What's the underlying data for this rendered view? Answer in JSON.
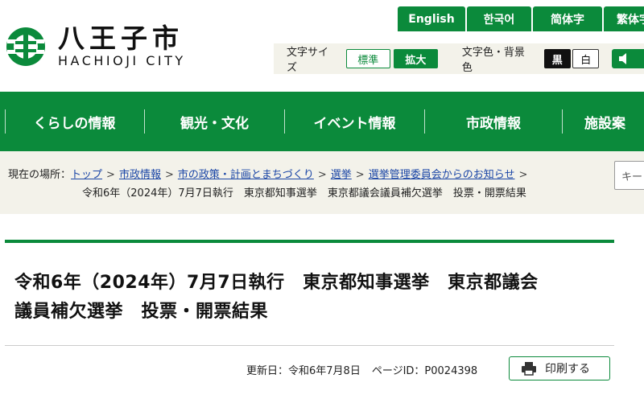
{
  "site": {
    "name_jp": "八王子市",
    "name_en": "HACHIOJI CITY",
    "logo_icon": "hachioji-emblem-icon",
    "brand_color": "#0b8a3b"
  },
  "languages": [
    "English",
    "한국어",
    "简体字",
    "繁体字"
  ],
  "tools": {
    "text_size_label": "文字サイズ",
    "size_standard": "標準",
    "size_large": "拡大",
    "color_label": "文字色・背景色",
    "color_black": "黒",
    "color_white": "白",
    "speaker_icon": "speaker-icon"
  },
  "nav": [
    "くらしの情報",
    "観光・文化",
    "イベント情報",
    "市政情報",
    "施設案"
  ],
  "breadcrumb": {
    "label": "現在の場所：",
    "links": [
      "トップ",
      "市政情報",
      "市の政策・計画とまちづくり",
      "選挙",
      "選挙管理委員会からのお知らせ"
    ],
    "current": "令和6年（2024年）7月7日執行　東京都知事選挙　東京都議会議員補欠選挙　投票・開票結果"
  },
  "search": {
    "placeholder": "キー"
  },
  "page": {
    "title_line1": "令和6年（2024年）7月7日執行　東京都知事選挙　東京都議会",
    "title_line2": "議員補欠選挙　投票・開票結果",
    "updated": "更新日：令和6年7月8日",
    "page_id": "ページID：P0024398",
    "print_label": "印刷する",
    "print_icon": "printer-icon"
  }
}
